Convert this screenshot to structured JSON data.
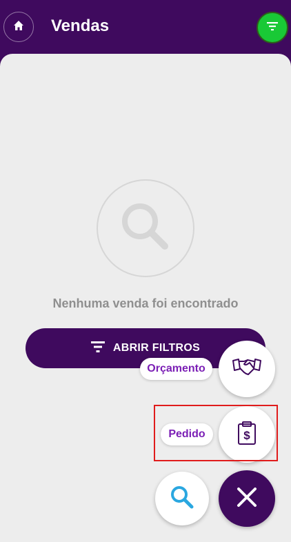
{
  "header": {
    "title": "Vendas",
    "home_icon": "home-icon",
    "filter_icon": "filter-icon",
    "filter_color": "#19c936"
  },
  "empty_state": {
    "icon": "search-icon",
    "message": "Nenhuma venda foi encontrado"
  },
  "filters_button": {
    "label": "ABRIR FILTROS",
    "icon": "filter-icon"
  },
  "fab_menu": {
    "items": [
      {
        "label": "Orçamento",
        "icon": "handshake-icon"
      },
      {
        "label": "Pedido",
        "icon": "clipboard-dollar-icon"
      }
    ],
    "search_icon": "search-icon",
    "close_icon": "close-icon"
  },
  "colors": {
    "primary": "#3f0a5e",
    "accent_green": "#19c936",
    "chip_text": "#7b1fb5",
    "search_blue": "#2aa7e0",
    "highlight": "#e01b1b"
  }
}
